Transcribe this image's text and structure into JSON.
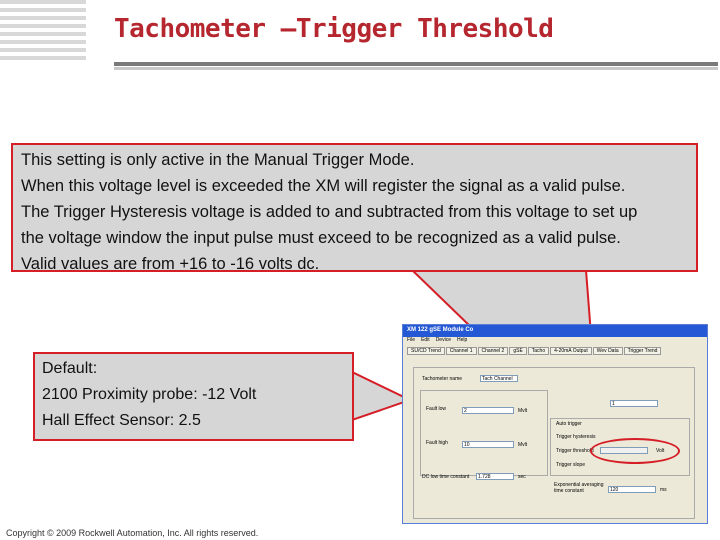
{
  "slide": {
    "title": "Tachometer –Trigger Threshold",
    "copyright": "Copyright © 2009 Rockwell Automation, Inc. All rights reserved."
  },
  "callout_main": {
    "lines": [
      "This setting is only active in the Manual Trigger Mode.",
      "When this voltage level is exceeded the XM will register the signal as a valid pulse.",
      "The Trigger Hysteresis voltage is added to and subtracted from this voltage to set up",
      "the voltage window the input pulse must exceed to be recognized as a valid pulse.",
      "Valid values are from +16 to -16 volts dc."
    ]
  },
  "callout_default": {
    "lines": [
      "Default:",
      "2100 Proximity probe: -12 Volt",
      "Hall Effect Sensor: 2.5"
    ]
  },
  "dialog": {
    "title": "XM 122 gSE Module Co",
    "menu": [
      "File",
      "Edit",
      "Device",
      "Help"
    ],
    "tabs": [
      "SU/CD Trend",
      "Channel 1",
      "Channel 2",
      "gSE",
      "Tacho",
      "4-20mA Output",
      "Wev Data",
      "Trigger Trend"
    ],
    "fields": {
      "tach_name_label": "Tachometer name",
      "tach_name_value": "Tach Channel",
      "fault_low_label": "Fault low",
      "fault_low_value": "2",
      "fault_high_label": "Fault high",
      "fault_high_value": "10",
      "unit_mv_1": "Mvlt",
      "unit_mv_2": "Mvlt",
      "dc_filter_label": "DC low time constant",
      "dc_filter_value": "1.728",
      "unit_sec": "sec",
      "pulses_value": "1",
      "auto_trigger": "Auto trigger",
      "trigger_hysteresis_label": "Trigger hysteresis",
      "trigger_threshold_label": "Trigger threshold",
      "trigger_threshold_unit": "Volt",
      "trigger_slope_label": "Trigger slope",
      "exp_avg_label": "Exponential averaging time constant",
      "exp_avg_value": "120",
      "unit_ms": "ms"
    }
  },
  "colors": {
    "accent": "#b5262e",
    "callout_border": "#d51e26",
    "callout_fill": "#d6d6d6"
  }
}
